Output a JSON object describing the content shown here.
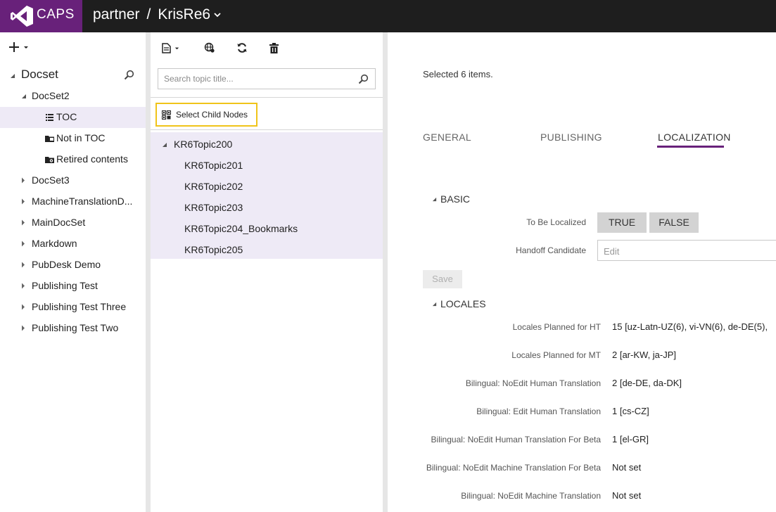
{
  "topbar": {
    "brand": "CAPS",
    "breadcrumb_root": "partner",
    "breadcrumb_sep": "/",
    "breadcrumb_current": "KrisRe6",
    "brand_color": "#68217a"
  },
  "left": {
    "add_icon": "plus-icon",
    "root_label": "Docset",
    "tree": [
      {
        "label": "DocSet2",
        "expanded": true
      },
      {
        "label": "TOC",
        "icon": "toc-list-icon",
        "selected": true
      },
      {
        "label": "Not in TOC",
        "icon": "folder-icon"
      },
      {
        "label": "Retired contents",
        "icon": "retired-folder-icon"
      },
      {
        "label": "DocSet3"
      },
      {
        "label": "MachineTranslationD..."
      },
      {
        "label": "MainDocSet"
      },
      {
        "label": "Markdown"
      },
      {
        "label": "PubDesk Demo"
      },
      {
        "label": "Publishing Test"
      },
      {
        "label": "Publishing Test Three"
      },
      {
        "label": "Publishing Test Two"
      }
    ]
  },
  "middle": {
    "search_placeholder": "Search topic title...",
    "select_child_nodes": "Select Child Nodes",
    "topics": [
      {
        "label": "KR6Topic200",
        "parent": true
      },
      {
        "label": "KR6Topic201"
      },
      {
        "label": "KR6Topic202"
      },
      {
        "label": "KR6Topic203"
      },
      {
        "label": "KR6Topic204_Bookmarks"
      },
      {
        "label": "KR6Topic205"
      }
    ],
    "selection_color": "#eeeaf6",
    "highlight_color": "#f0c419"
  },
  "right": {
    "selected_text": "Selected 6 items.",
    "tabs": [
      "GENERAL",
      "PUBLISHING",
      "LOCALIZATION"
    ],
    "active_tab": "LOCALIZATION",
    "basic_header": "BASIC",
    "to_be_localized_label": "To Be Localized",
    "true_label": "TRUE",
    "false_label": "FALSE",
    "handoff_label": "Handoff Candidate",
    "handoff_placeholder": "Edit",
    "save_label": "Save",
    "locales_header": "LOCALES",
    "locale_rows": [
      {
        "label": "Locales Planned for HT",
        "value": "15 [uz-Latn-UZ(6), vi-VN(6), de-DE(5),"
      },
      {
        "label": "Locales Planned for MT",
        "value": "2 [ar-KW, ja-JP]"
      },
      {
        "label": "Bilingual: NoEdit Human Translation",
        "value": "2 [de-DE, da-DK]"
      },
      {
        "label": "Bilingual: Edit Human Translation",
        "value": "1 [cs-CZ]"
      },
      {
        "label": "Bilingual: NoEdit Human Translation For Beta",
        "value": "1 [el-GR]"
      },
      {
        "label": "Bilingual: NoEdit Machine Translation For Beta",
        "value": "Not set"
      },
      {
        "label": "Bilingual: NoEdit Machine Translation",
        "value": "Not set"
      }
    ]
  }
}
